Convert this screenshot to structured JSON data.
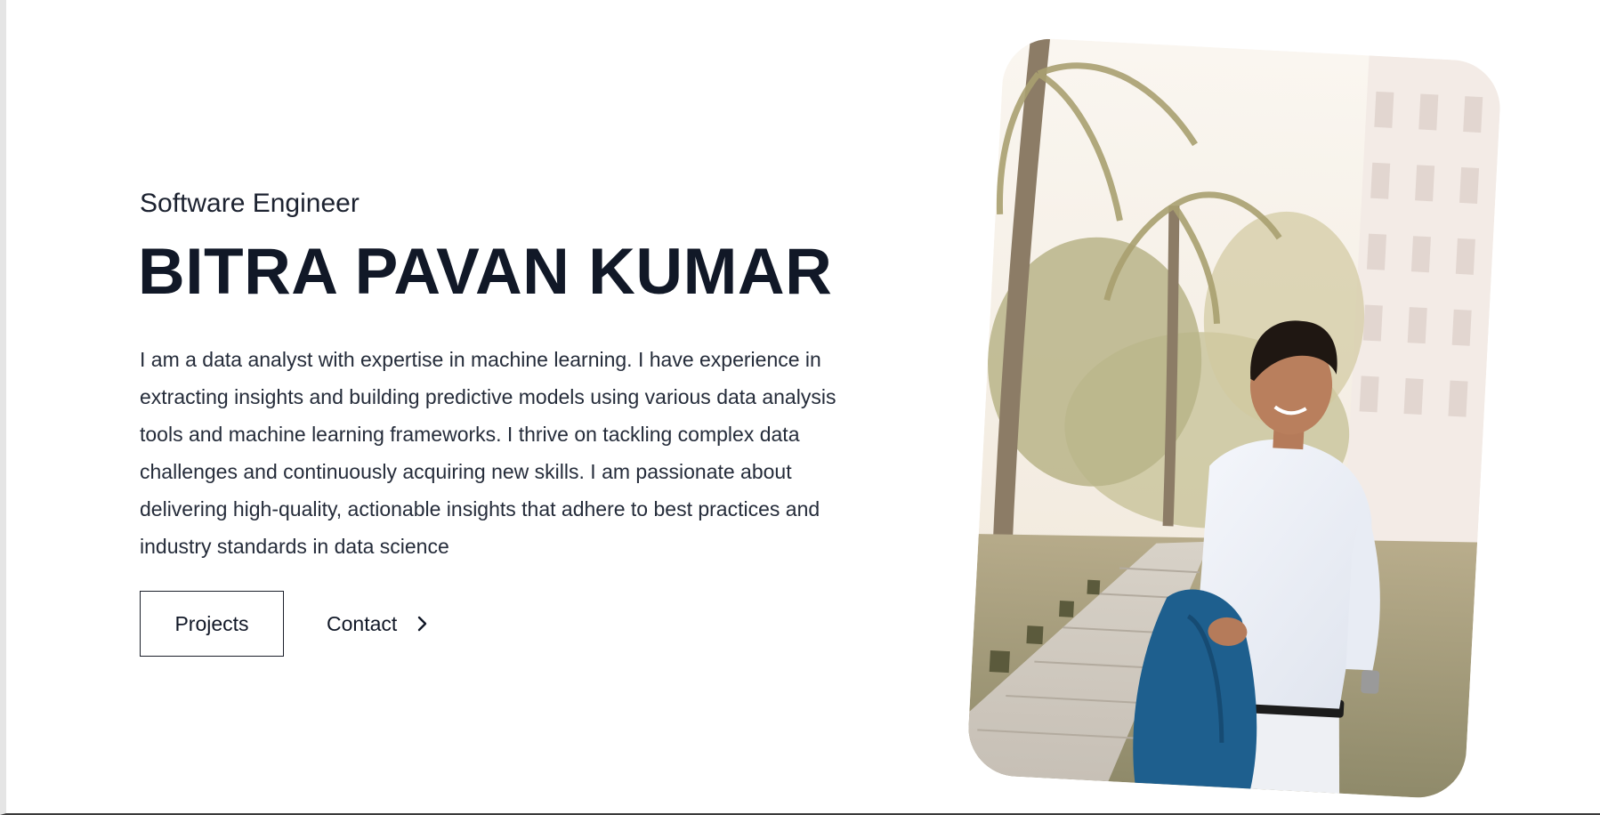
{
  "hero": {
    "subtitle": "Software Engineer",
    "name": "BITRA PAVAN KUMAR",
    "bio": "I am a data analyst with expertise in machine learning. I have experience in extracting insights and building predictive models using various data analysis tools and machine learning frameworks. I thrive on tackling complex data challenges and continuously acquiring new skills. I am passionate about delivering high-quality, actionable insights that adhere to best practices and industry standards in data science"
  },
  "actions": {
    "projects_label": "Projects",
    "contact_label": "Contact",
    "contact_icon": "chevron-right-icon"
  },
  "colors": {
    "text_primary": "#111827",
    "background": "#ffffff"
  }
}
